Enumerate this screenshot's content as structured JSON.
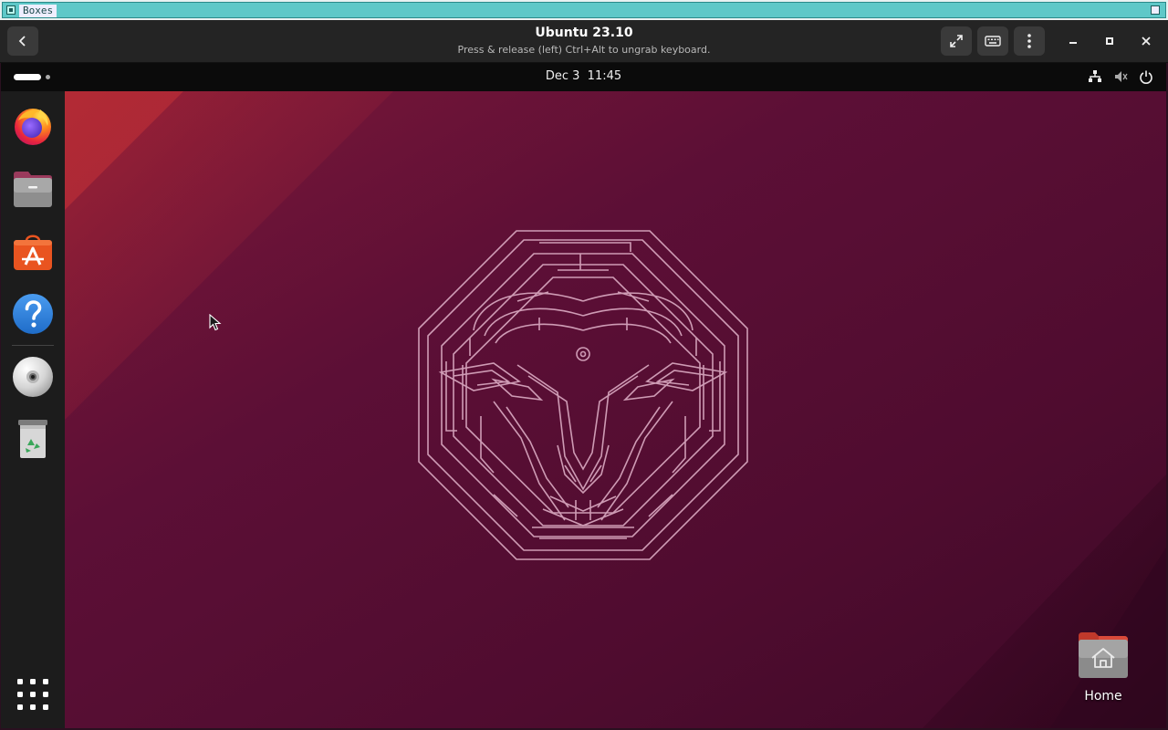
{
  "host": {
    "title": "Boxes"
  },
  "window": {
    "title": "Ubuntu 23.10",
    "subtitle": "Press & release (left) Ctrl+Alt to ungrab keyboard."
  },
  "panel": {
    "clock": "Dec 3  11:45"
  },
  "dock": {
    "items": [
      {
        "name": "firefox-icon"
      },
      {
        "name": "files-icon"
      },
      {
        "name": "app-center-icon"
      },
      {
        "name": "help-icon"
      },
      {
        "name": "optical-disc-icon"
      },
      {
        "name": "trash-icon"
      }
    ]
  },
  "desktop": {
    "home_label": "Home"
  },
  "colors": {
    "accent": "#e95420",
    "wallpaper": "#5a0e34",
    "dock": "#1c1c1c",
    "headerbar": "#242424"
  }
}
